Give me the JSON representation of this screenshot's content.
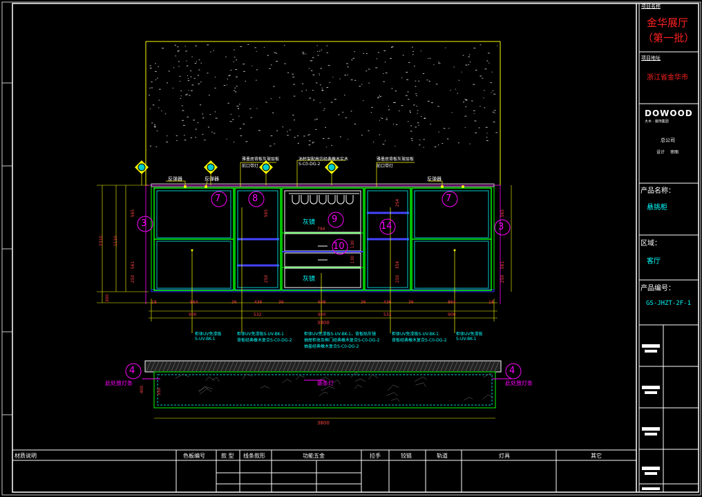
{
  "title_block": {
    "project_name_label": "项目名称",
    "project_name": "金华展厅",
    "project_name_sub": "（第一批）",
    "project_location_label": "项目地址",
    "project_location": "浙江省金华市",
    "company_logo": "DOWOOD",
    "company_logo_sub": "大木 · 装饰集团",
    "company": "总公司",
    "designer_label": "设计",
    "checker_label": "审图",
    "product_name_label": "产品名称：",
    "product_name": "悬挑柜",
    "area_label": "区域：",
    "area": "客厅",
    "product_code_label": "产品编号：",
    "product_code": "GS-JHZT-2F-1"
  },
  "bottom_table": {
    "headers": [
      "材质说明",
      "色板编号",
      "款 型",
      "线条款形",
      "功能五金",
      "拉手",
      "铰链",
      "轨道",
      "灯具",
      "其它"
    ]
  },
  "elevation": {
    "callouts_top": [
      {
        "text": "反弹器",
        "id": "rebound-left"
      },
      {
        "text": "反弹器",
        "id": "rebound-2"
      },
      {
        "text": "雅墨居背板灰玻层板",
        "id": "note-1a"
      },
      {
        "text": "前口带灯",
        "id": "note-1b"
      },
      {
        "text": "油杯架配高仿经典橡木实木",
        "id": "note-2a"
      },
      {
        "text": "S-C0-DG-2",
        "id": "note-2b"
      },
      {
        "text": "雅墨居背板灰玻层板",
        "id": "note-3a"
      },
      {
        "text": "前口带灯",
        "id": "note-3b"
      },
      {
        "text": "反弹器",
        "id": "rebound-right"
      }
    ],
    "circle_tags": [
      "7",
      "8",
      "9",
      "10",
      "14",
      "7",
      "3",
      "3",
      "4",
      "4"
    ],
    "glass_labels": [
      "灰镜",
      "灰镜"
    ],
    "dims_bottom": [
      "18",
      "864",
      "36",
      "436",
      "36",
      "608",
      "36",
      "436",
      "36",
      "864",
      "18"
    ],
    "dims_bottom2": [
      "900",
      "532",
      "920",
      "532",
      "900"
    ],
    "overall_width": "3800",
    "dims_left": [
      "2310",
      "1110",
      "565",
      "561",
      "250",
      "300"
    ],
    "dims_right": [
      "565",
      "561",
      "250"
    ],
    "dims_mid": [
      "565",
      "250",
      "794",
      "130",
      "130",
      "254",
      "354",
      "250"
    ],
    "material_notes": [
      {
        "line1": "柜体UV免漆板",
        "line2": "S-UV-BK-1"
      },
      {
        "line1": "柜体UV免漆板S-UV-BK-1",
        "line2": "背板经典橡木复合S-C0-DG-2"
      },
      {
        "line1": "柜体UV免漆板S-UV-BK-1，背板贴灰镜",
        "line2": "抽屉柜体及框门经典橡木复合S-C0-DG-2",
        "line3": "抽盖经典橡木复合S-C0-DG-2"
      },
      {
        "line1": "柜体UV免漆板S-UV-BK-1",
        "line2": "背板经典橡木复合S-C0-DG-2"
      },
      {
        "line1": "柜体UV免漆板",
        "line2": "S-UV-BK-1"
      }
    ],
    "plan_labels": {
      "left": "此处放灯条",
      "center": "嵌条灯",
      "right": "此处放灯条"
    },
    "plan_width": "3800",
    "plan_depth": [
      "400",
      "350"
    ]
  },
  "colors": {
    "background": "#000000",
    "frame": "#ffffff",
    "cyan": "#00ffff",
    "magenta": "#ff00ff",
    "green": "#00ff00",
    "yellow": "#ffff00",
    "red": "#ff2020",
    "blue": "#3333ff"
  }
}
